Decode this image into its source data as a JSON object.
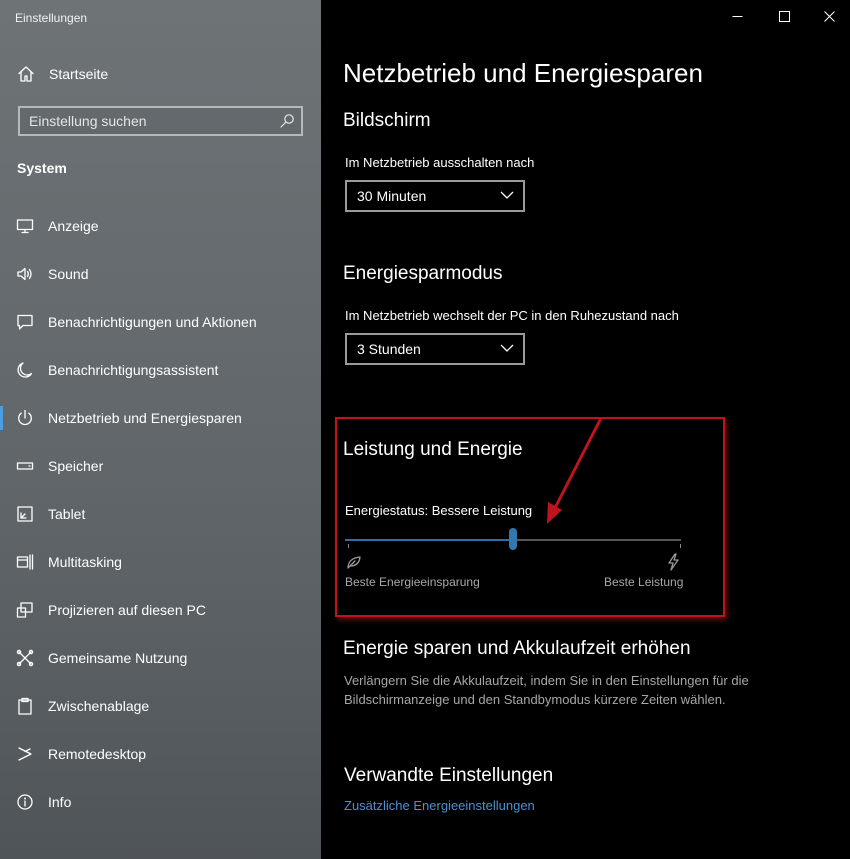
{
  "window": {
    "title": "Einstellungen",
    "controls": {
      "minimize": "minimize-icon",
      "maximize": "maximize-icon",
      "close": "close-icon"
    }
  },
  "sidebar": {
    "home_label": "Startseite",
    "search_placeholder": "Einstellung suchen",
    "section_title": "System",
    "accent_color": "#4b9fe0",
    "items": [
      {
        "label": "Anzeige",
        "icon": "display-icon",
        "active": false
      },
      {
        "label": "Sound",
        "icon": "speaker-icon",
        "active": false
      },
      {
        "label": "Benachrichtigungen und Aktionen",
        "icon": "notification-icon",
        "active": false
      },
      {
        "label": "Benachrichtigungsassistent",
        "icon": "moon-icon",
        "active": false
      },
      {
        "label": "Netzbetrieb und Energiesparen",
        "icon": "power-icon",
        "active": true
      },
      {
        "label": "Speicher",
        "icon": "storage-icon",
        "active": false
      },
      {
        "label": "Tablet",
        "icon": "tablet-icon",
        "active": false
      },
      {
        "label": "Multitasking",
        "icon": "multitasking-icon",
        "active": false
      },
      {
        "label": "Projizieren auf diesen PC",
        "icon": "project-icon",
        "active": false
      },
      {
        "label": "Gemeinsame Nutzung",
        "icon": "share-icon",
        "active": false
      },
      {
        "label": "Zwischenablage",
        "icon": "clipboard-icon",
        "active": false
      },
      {
        "label": "Remotedesktop",
        "icon": "remote-desktop-icon",
        "active": false
      },
      {
        "label": "Info",
        "icon": "info-icon",
        "active": false
      }
    ]
  },
  "main": {
    "page_title": "Netzbetrieb und Energiesparen",
    "screen": {
      "heading": "Bildschirm",
      "label": "Im Netzbetrieb ausschalten nach",
      "value": "30 Minuten"
    },
    "sleep": {
      "heading": "Energiesparmodus",
      "label": "Im Netzbetrieb wechselt der PC in den Ruhezustand nach",
      "value": "3 Stunden"
    },
    "power": {
      "heading": "Leistung und Energie",
      "status_label": "Energiestatus: Bessere Leistung",
      "slider_position": 0.5,
      "left_label": "Beste Energieeinsparung",
      "right_label": "Beste Leistung",
      "highlight_color": "#c0141c"
    },
    "battery": {
      "heading": "Energie sparen und Akkulaufzeit erhöhen",
      "text": "Verlängern Sie die Akkulaufzeit, indem Sie in den Einstellungen für die Bildschirmanzeige und den Standbymodus kürzere Zeiten wählen."
    },
    "related": {
      "heading": "Verwandte Einstellungen",
      "link": "Zusätzliche Energieeinstellungen",
      "link_color": "#4d8fd0"
    }
  }
}
